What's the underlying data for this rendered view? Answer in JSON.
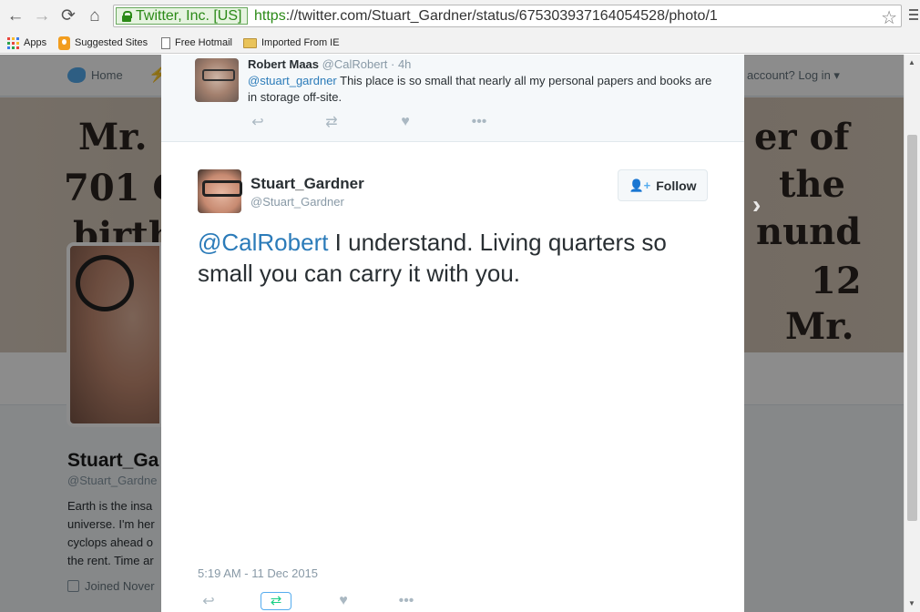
{
  "browser": {
    "ev_badge": "Twitter, Inc. [US]",
    "url_scheme": "https",
    "url_rest": "://twitter.com/Stuart_Gardner/status/675303937164054528/photo/1",
    "nav_icons": [
      "back-icon",
      "forward-icon",
      "reload-icon",
      "home-icon"
    ]
  },
  "bookmarks": [
    {
      "label": "Apps",
      "icon": "apps-icon"
    },
    {
      "label": "Suggested Sites",
      "icon": "bulb-icon"
    },
    {
      "label": "Free Hotmail",
      "icon": "page-icon"
    },
    {
      "label": "Imported From IE",
      "icon": "folder-icon"
    }
  ],
  "site": {
    "nav_home": "Home",
    "login_prompt": "account? Log in",
    "banner_lines": [
      "Mr.",
      "701 C",
      "birth",
      "er of",
      "the",
      "nund",
      "12",
      "Mr."
    ]
  },
  "profile": {
    "name": "Stuart_Ga",
    "handle": "@Stuart_Gardne",
    "bio": "Earth is the insa universe. I'm her cyclops ahead o the rent. Time ar",
    "joined": "Joined Nover"
  },
  "reply_tweet": {
    "name": "Robert Maas",
    "handle": "@CalRobert",
    "time": "· 4h",
    "mention": "@stuart_gardner",
    "text": " This place is so small that nearly all my personal papers and books are in storage off-site."
  },
  "main_tweet": {
    "name": "Stuart_Gardner",
    "handle": "@Stuart_Gardner",
    "follow_label": "Follow",
    "mention": "@CalRobert",
    "text": " I understand. Living quarters so small you can carry it with you.",
    "timestamp": "5:19 AM - 11 Dec 2015"
  },
  "colors": {
    "link": "#2b7bb9",
    "twitter_blue": "#55acee",
    "retweet_green": "#19cf86",
    "ev_green": "#2b8a17"
  }
}
